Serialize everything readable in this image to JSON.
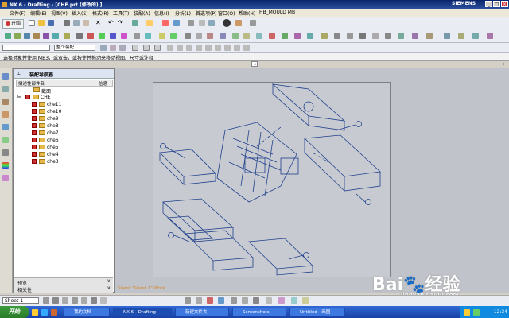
{
  "window": {
    "title": "NX 6 - Drafting - [CHE.prt (修改的) ]",
    "brand": "SIEMENS",
    "minimize_icon": "minimize-icon",
    "maximize_icon": "maximize-icon",
    "close_icon": "close-icon"
  },
  "menubar": {
    "items": [
      "文件(F)",
      "编辑(E)",
      "视图(V)",
      "插入(S)",
      "格式(R)",
      "工具(T)",
      "装配(A)",
      "信息(I)",
      "分析(L)",
      "首选项(P)",
      "窗口(O)",
      "帮助(H)",
      "HB_MOULD MB"
    ]
  },
  "toolbar": {
    "start_label": "开始",
    "layer_selector": "整个装配"
  },
  "cue_line": "选择对象并使用 MB3，或双击，或按住并拖动来移动视图。尺寸或注释",
  "navigator": {
    "title": "装配导航器",
    "col_name": "描述性部件名",
    "col_info": "信息",
    "rows": [
      {
        "label": "截面",
        "level": 1,
        "checked": false
      },
      {
        "label": "CHE",
        "level": 1,
        "checked": true
      },
      {
        "label": "che11",
        "level": 2,
        "checked": true
      },
      {
        "label": "che10",
        "level": 2,
        "checked": true
      },
      {
        "label": "che9",
        "level": 2,
        "checked": true
      },
      {
        "label": "che8",
        "level": 2,
        "checked": true
      },
      {
        "label": "che7",
        "level": 2,
        "checked": true
      },
      {
        "label": "che6",
        "level": 2,
        "checked": true
      },
      {
        "label": "che5",
        "level": 2,
        "checked": true
      },
      {
        "label": "che4",
        "level": 2,
        "checked": true
      },
      {
        "label": "che3",
        "level": 2,
        "checked": true
      }
    ],
    "preview_label": "预览",
    "dependencies_label": "相关性"
  },
  "canvas": {
    "watermark": "Sheet \"Sheet 1\" Work"
  },
  "bottom_toolbar": {
    "sheet_selector": "Sheet 1"
  },
  "taskbar": {
    "start": "开始",
    "tasks": [
      "我的文档",
      "NX 6 - Drafting",
      "新建文件夹",
      "Screenshots",
      "Untitled - 画图"
    ],
    "clock": "12:34"
  },
  "watermark_brand": {
    "main": "Bai🐾经验",
    "sub": "jingyan.baidu.com"
  },
  "colors": {
    "title_bar": "#0a246a",
    "drawing_lines": "#1e3f8c",
    "sheet_bg": "#c7cbd1",
    "taskbar": "#1941a5",
    "start_button": "#2a7d2a"
  }
}
